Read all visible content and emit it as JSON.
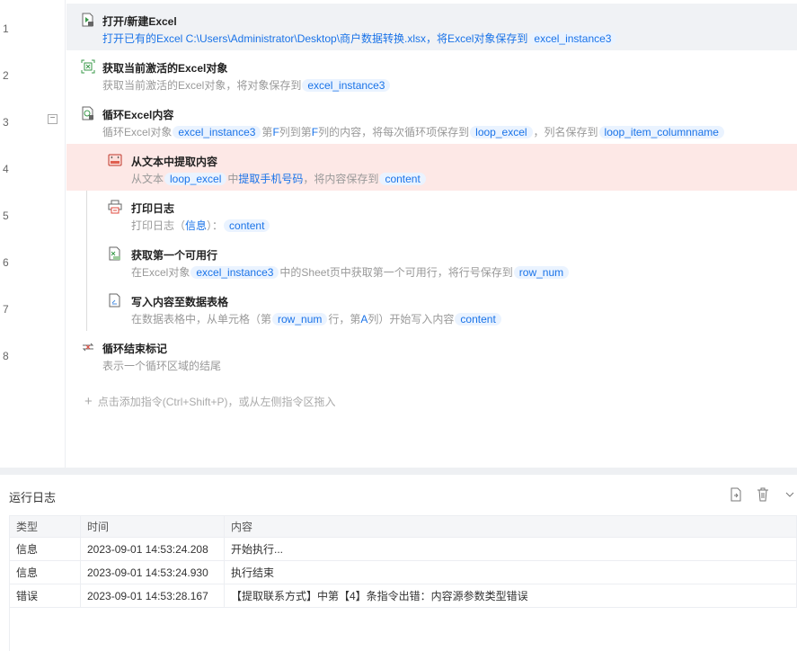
{
  "steps": [
    {
      "num": "1",
      "icon": "excel-open-icon",
      "title": "打开/新建Excel",
      "desc": [
        {
          "t": "打开已有的Excel C:\\Users\\Administrator\\Desktop\\商户数据转换.xlsx，将Excel对象保存到",
          "k": "b"
        },
        {
          "t": "excel_instance3",
          "k": "pill"
        }
      ]
    },
    {
      "num": "2",
      "icon": "excel-active-icon",
      "title": "获取当前激活的Excel对象",
      "desc": [
        {
          "t": "获取当前激活的Excel对象，将对象保存到",
          "k": ""
        },
        {
          "t": "excel_instance3",
          "k": "pill"
        }
      ]
    },
    {
      "num": "3",
      "icon": "excel-loop-icon",
      "title": "循环Excel内容",
      "desc": [
        {
          "t": "循环Excel对象",
          "k": ""
        },
        {
          "t": "excel_instance3",
          "k": "pill"
        },
        {
          "t": "第",
          "k": ""
        },
        {
          "t": "F",
          "k": "b"
        },
        {
          "t": "列到第",
          "k": ""
        },
        {
          "t": "F",
          "k": "b"
        },
        {
          "t": "列的内容，将每次循环项保存到",
          "k": ""
        },
        {
          "t": "loop_excel",
          "k": "pill"
        },
        {
          "t": "，列名保存到",
          "k": ""
        },
        {
          "t": "loop_item_columnname",
          "k": "pill"
        }
      ]
    },
    {
      "num": "4",
      "icon": "text-extract-icon",
      "title": "从文本中提取内容",
      "desc": [
        {
          "t": "从文本",
          "k": ""
        },
        {
          "t": "loop_excel",
          "k": "pill"
        },
        {
          "t": "中",
          "k": ""
        },
        {
          "t": "提取手机号码",
          "k": "b"
        },
        {
          "t": "，将内容保存到",
          "k": ""
        },
        {
          "t": "content",
          "k": "pill"
        }
      ]
    },
    {
      "num": "5",
      "icon": "printer-icon",
      "title": "打印日志",
      "desc": [
        {
          "t": "打印日志（",
          "k": ""
        },
        {
          "t": "信息",
          "k": "b"
        },
        {
          "t": "）：",
          "k": ""
        },
        {
          "t": "content",
          "k": "pill"
        }
      ]
    },
    {
      "num": "6",
      "icon": "excel-row-icon",
      "title": "获取第一个可用行",
      "desc": [
        {
          "t": "在Excel对象",
          "k": ""
        },
        {
          "t": "excel_instance3",
          "k": "pill"
        },
        {
          "t": "中的Sheet页中获取第一个可用行，将行号保存到",
          "k": ""
        },
        {
          "t": "row_num",
          "k": "pill"
        }
      ]
    },
    {
      "num": "7",
      "icon": "write-table-icon",
      "title": "写入内容至数据表格",
      "desc": [
        {
          "t": "在数据表格中，从单元格（第",
          "k": ""
        },
        {
          "t": "row_num",
          "k": "pill"
        },
        {
          "t": "行，第",
          "k": ""
        },
        {
          "t": "A",
          "k": "b"
        },
        {
          "t": "列）开始写入内容",
          "k": ""
        },
        {
          "t": "content",
          "k": "pill"
        }
      ]
    },
    {
      "num": "8",
      "icon": "loop-end-icon",
      "title": "循环结束标记",
      "desc": [
        {
          "t": "表示一个循环区域的结尾",
          "k": ""
        }
      ]
    }
  ],
  "collapse_symbol": "−",
  "add_hint": {
    "plus": "+",
    "text": "点击添加指令(Ctrl+Shift+P)，或从左侧指令区拖入"
  },
  "log": {
    "title": "运行日志",
    "columns": [
      "类型",
      "时间",
      "内容"
    ],
    "rows": [
      [
        "信息",
        "2023-09-01 14:53:24.208",
        "开始执行..."
      ],
      [
        "信息",
        "2023-09-01 14:53:24.930",
        "执行结束"
      ],
      [
        "错误",
        "2023-09-01 14:53:28.167",
        "【提取联系方式】中第【4】条指令出错：内容源参数类型错误"
      ]
    ]
  }
}
